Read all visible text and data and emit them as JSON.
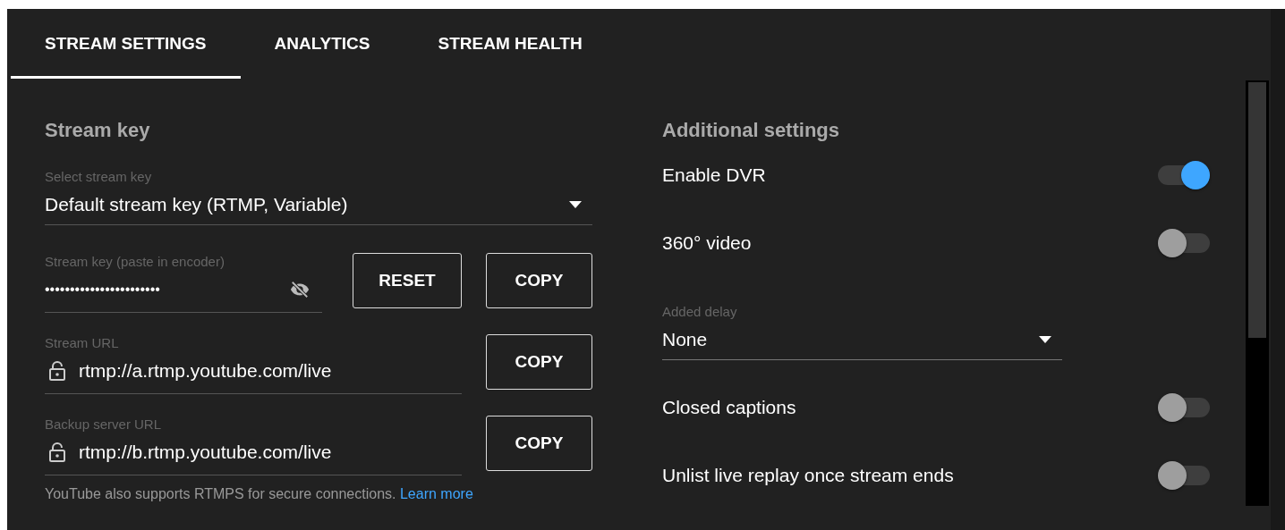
{
  "tabs": [
    {
      "label": "STREAM SETTINGS",
      "selected": true
    },
    {
      "label": "ANALYTICS",
      "selected": false
    },
    {
      "label": "STREAM HEALTH",
      "selected": false
    }
  ],
  "stream_key": {
    "heading": "Stream key",
    "select": {
      "label": "Select stream key",
      "value": "Default stream key (RTMP, Variable)"
    },
    "fields": [
      {
        "kind": "secret",
        "label": "Stream key (paste in encoder)",
        "value": "•••••••••••••••••••••••",
        "buttons": [
          "RESET",
          "COPY"
        ]
      },
      {
        "kind": "url",
        "label": "Stream URL",
        "value": "rtmp://a.rtmp.youtube.com/live",
        "buttons": [
          "COPY"
        ]
      },
      {
        "kind": "url",
        "label": "Backup server URL",
        "value": "rtmp://b.rtmp.youtube.com/live",
        "buttons": [
          "COPY"
        ]
      }
    ],
    "note": {
      "text": "YouTube also supports RTMPS for secure connections.",
      "link": "Learn more"
    }
  },
  "additional_settings": {
    "heading": "Additional settings",
    "items": [
      {
        "kind": "toggle",
        "label": "Enable DVR",
        "on": true
      },
      {
        "kind": "toggle",
        "label": "360° video",
        "on": false
      },
      {
        "kind": "select",
        "label": "Added delay",
        "value": "None"
      },
      {
        "kind": "toggle",
        "label": "Closed captions",
        "on": false
      },
      {
        "kind": "toggle",
        "label": "Unlist live replay once stream ends",
        "on": false
      }
    ]
  }
}
